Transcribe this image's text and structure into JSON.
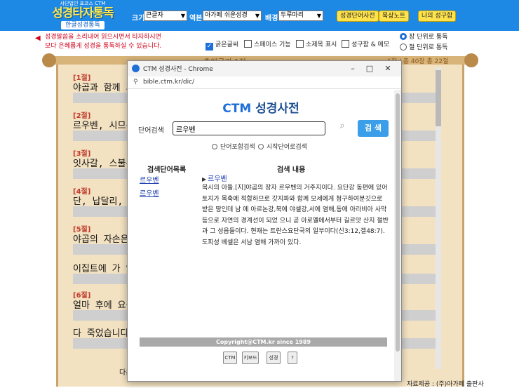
{
  "header": {
    "logo_sub": "사단법인 표코스 CTM",
    "logo_main": "성경타자통독",
    "logo_tag": "한글성경통독",
    "size_label": "크기",
    "size_value": "큰글자",
    "version_label": "역본",
    "version_value": "아가페 쉬운성경",
    "bg_label": "배경",
    "bg_value": "두루마리",
    "btn_dictionary": "성경단어사전",
    "btn_note": "묵상노트",
    "btn_my_verse": "나의 성구함"
  },
  "notice": {
    "line1": "성경말씀을 소리내어 읽으시면서 타자하시면",
    "line2": "보다 은혜롭게 성경을 통독하실 수 있습니다."
  },
  "options": {
    "bold": "굵은글씨",
    "space": "스페이스 기능",
    "subtitle": "소제목 표시",
    "verse_memo": "성구함 & 메모",
    "chapter_unit": "장 단위로 통독",
    "verse_unit": "절 단위로 통독",
    "chapter_unit_prefix": "장",
    "verse_unit_prefix": "절"
  },
  "scroll": {
    "title": "출애굽기 1장",
    "count": "1장 / 총 40장   총 22절",
    "verses": [
      {
        "no": "[1절]",
        "text": "야곱과 함께 가"
      },
      {
        "no": "[2절]",
        "text": "르우벤, 시므온"
      },
      {
        "no": "[3절]",
        "text": "잇사갈, 스불론"
      },
      {
        "no": "[4절]",
        "text": "단, 납달리, 갓"
      },
      {
        "no": "[5절]",
        "text": "야곱의 자손은"
      },
      {
        "no": "",
        "text": "이집트에 가 있"
      },
      {
        "no": "[6절]",
        "text": "얼마 후에 요셉"
      },
      {
        "no": "",
        "text": "다 죽었습니다"
      }
    ],
    "bottom_text": "다음",
    "credits": "자료제공 : (주)아가페 출판사"
  },
  "popup": {
    "window_title": "CTM 성경사전 - Chrome",
    "url": "bible.ctm.kr/dic/",
    "dict_title_1": "CTM",
    "dict_title_2": "성경사전",
    "search_label": "단어검색",
    "search_value": "르우벤",
    "search_button": "검 색",
    "opt_include": "단어포함검색",
    "opt_start": "시작단어로검색",
    "list_header": "검색단어목록",
    "content_header": "검색 내용",
    "list_items": [
      "르우벤",
      "르우벤"
    ],
    "result_word": "르우벤",
    "result_body": "목시의 아들.[지]야곱의 장자 르우벤의 거주지이다. 요단강 동편에 있어 토지가 목축에 적합하므로 갓지파와 함께 모세에게 청구하여분깃으로 받은 땅인데 남 에 아르논강,북에 야셀강,서에 염해,동에 아라비아 사막등으로 자연의 경계선이 되었 으니 곧 아로엘에서부터 길르앗 산지 절반과 그 성읍들이다. 현재는 트란스요단국의 일부이다(신3:12,겔48:7). 도피성 베셀은 서남 염해 가까이 있다.",
    "footer": "Copyright@CTM.kr since 1989",
    "footer_icons": [
      "CTM",
      "키보드",
      "성경",
      "?"
    ]
  }
}
